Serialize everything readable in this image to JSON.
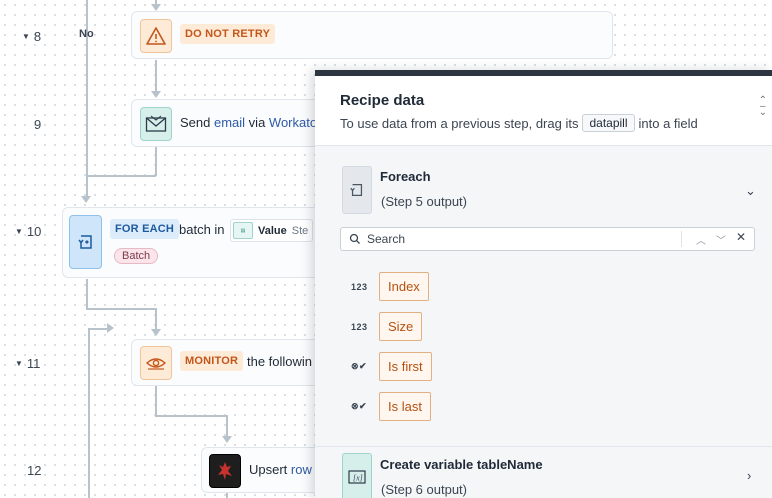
{
  "canvas": {
    "no_label": "No",
    "steps": [
      {
        "num": "8",
        "tag": "DO NOT RETRY"
      },
      {
        "num": "9",
        "text_pre": "Send ",
        "keyword": "email",
        "text_mid": " via ",
        "app": "Workato"
      },
      {
        "num": "10",
        "tag": "FOR EACH",
        "text": "batch in",
        "value_label": "Value",
        "value_suffix": "Ste",
        "pill": "Batch"
      },
      {
        "num": "11",
        "tag": "MONITOR",
        "text": "the followin"
      },
      {
        "num": "12",
        "text_pre": "Upsert ",
        "keyword": "row"
      }
    ]
  },
  "panel": {
    "title": "Recipe data",
    "subtitle_pre": "To use data from a previous step, drag its",
    "subtitle_chip": "datapill",
    "subtitle_post": "into a field",
    "sources": [
      {
        "title": "Foreach",
        "subtitle": "(Step 5 output)",
        "expanded": true
      },
      {
        "title": "Create variable tableName",
        "subtitle": "(Step 6 output)",
        "expanded": false
      }
    ],
    "search_placeholder": "Search",
    "fields": [
      {
        "type_icon": "123",
        "label": "Index"
      },
      {
        "type_icon": "123",
        "label": "Size"
      },
      {
        "type_icon": "⊗✔",
        "label": "Is first"
      },
      {
        "type_icon": "⊗✔",
        "label": "Is last"
      }
    ]
  },
  "colors": {
    "accent_orange": "#c4561a",
    "accent_blue": "#1d5a9e",
    "datapill_border": "#e3b083",
    "panel_bar": "#2d3540"
  }
}
